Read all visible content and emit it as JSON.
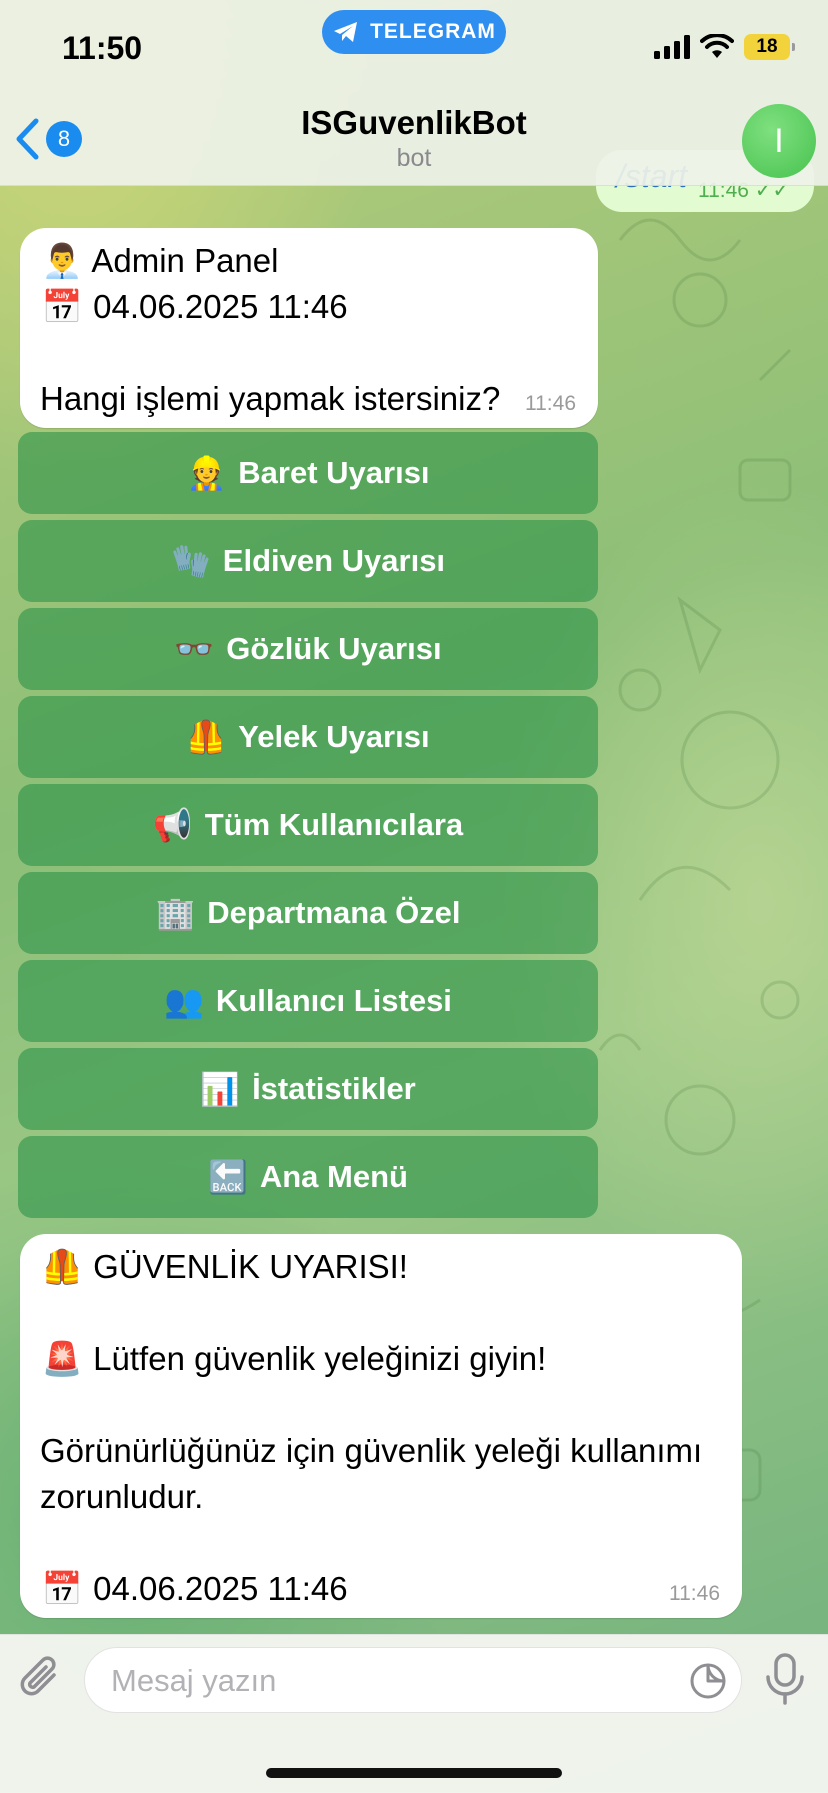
{
  "status_bar": {
    "time": "11:50",
    "app_pill": "TELEGRAM",
    "battery": "18"
  },
  "header": {
    "back_badge": "8",
    "title": "ISGuvenlikBot",
    "subtitle": "bot",
    "avatar_letter": "I"
  },
  "outgoing": {
    "text": "/start",
    "time": "11:46"
  },
  "admin_message": {
    "line1_icon": "👨‍💼",
    "line1": "Admin Panel",
    "line2_icon": "📅",
    "line2": "04.06.2025 11:46",
    "line3": "Hangi işlemi yapmak istersiniz?",
    "time": "11:46"
  },
  "keyboard": [
    {
      "icon": "👷",
      "label": "Baret Uyarısı"
    },
    {
      "icon": "🧤",
      "label": "Eldiven Uyarısı"
    },
    {
      "icon": "👓",
      "label": "Gözlük Uyarısı"
    },
    {
      "icon": "🦺",
      "label": "Yelek Uyarısı"
    },
    {
      "icon": "📢",
      "label": "Tüm Kullanıcılara"
    },
    {
      "icon": "🏢",
      "label": "Departmana Özel"
    },
    {
      "icon": "👥",
      "label": "Kullanıcı Listesi"
    },
    {
      "icon": "📊",
      "label": "İstatistikler"
    },
    {
      "icon": "🔙",
      "label": "Ana Menü"
    }
  ],
  "alert_message": {
    "line1_icon": "🦺",
    "line1": "GÜVENLİK UYARISI!",
    "line2_icon": "🚨",
    "line2": "Lütfen güvenlik yeleğinizi giyin!",
    "line3": "Görünürlüğünüz için güvenlik yeleği kullanımı",
    "line4": "zorunludur.",
    "line5_icon": "📅",
    "line5": "04.06.2025 11:46",
    "time": "11:46"
  },
  "input": {
    "placeholder": "Mesaj yazın"
  },
  "icons": {
    "attach": "paperclip-icon",
    "sticker": "sticker-icon",
    "mic": "microphone-icon",
    "back": "chevron-left-icon"
  },
  "colors": {
    "accent": "#1a8cf0",
    "bubble_out": "#e3fbd0",
    "keyboard_button": "#3a9a55"
  }
}
